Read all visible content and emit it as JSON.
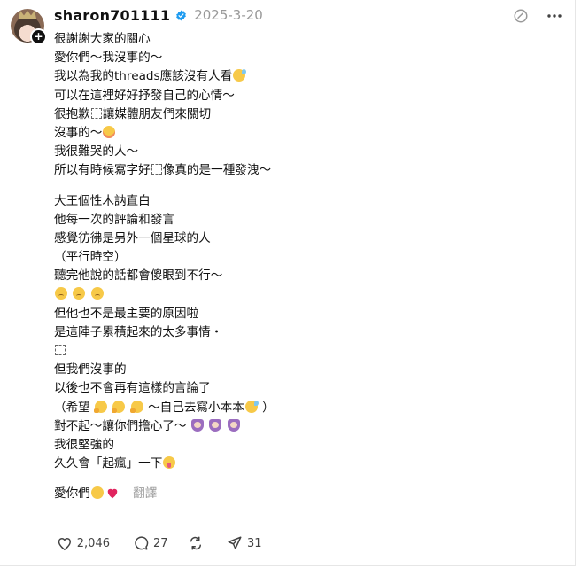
{
  "post": {
    "username": "sharon701111",
    "date": "2025-3-20",
    "lines": [
      "很謝謝大家的關心",
      "愛你們～我沒事的～",
      "我以為我的threads應該沒有人看",
      "可以在這裡好好抒發自己的心情～",
      "很抱歉",
      "讓媒體朋友們來關切",
      "沒事的～",
      "我很難哭的人～",
      "所以有時候寫字好",
      "像真的是一種發洩～",
      "大王個性木訥直白",
      "他每一次的評論和發言",
      "感覺彷彿是另外一個星球的人",
      "（平行時空）",
      "聽完他說的話都會傻眼到不行～",
      "但他也不是最主要的原因啦",
      "是這陣子累積起來的太多事情・",
      "但我們沒事的",
      "以後也不會再有這樣的言論了",
      "（希望",
      "～自己去寫小本本",
      "）",
      "對不起～讓你們擔心了～",
      "我很堅強的",
      "久久會「起瘋」一下",
      "愛你們"
    ],
    "translate_label": "翻譯"
  },
  "actions": {
    "likes": "2,046",
    "comments": "27",
    "shares": "31"
  },
  "icons": {
    "verified": "verified-badge-icon",
    "follow": "plus-icon",
    "mute": "mute-icon",
    "more": "more-icon",
    "like": "heart-icon",
    "comment": "comment-icon",
    "repost": "repost-icon",
    "share": "share-icon"
  },
  "colors": {
    "verified": "#1d9bf0",
    "text": "#101010",
    "muted": "#999999",
    "heart": "#e0245e"
  }
}
